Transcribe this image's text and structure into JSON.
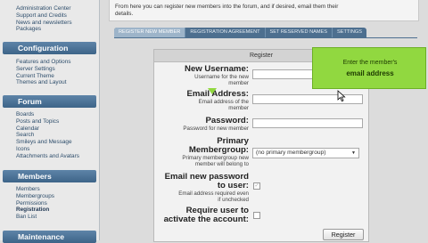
{
  "sidebar": {
    "top_links": [
      "Administration Center",
      "Support and Credits",
      "News and newsletters",
      "Packages"
    ],
    "sections": [
      {
        "title": "Configuration",
        "items": [
          "Features and Options",
          "Server Settings",
          "Current Theme",
          "Themes and Layout"
        ]
      },
      {
        "title": "Forum",
        "items": [
          "Boards",
          "Posts and Topics",
          "Calendar",
          "Search",
          "Smileys and Message Icons",
          "Attachments and Avatars"
        ]
      },
      {
        "title": "Members",
        "items": [
          "Members",
          "Membergroups",
          "Permissions",
          "Registration",
          "Ban List"
        ]
      },
      {
        "title": "Maintenance",
        "items": []
      }
    ],
    "active_item": "Registration"
  },
  "intro": {
    "line1": "From here you can register new members into the forum, and if desired, email them their",
    "line2": "details."
  },
  "tabs": [
    "Register New Member",
    "Registration Agreement",
    "Set Reserved Names",
    "Settings"
  ],
  "panel": {
    "title": "Register",
    "username": {
      "label": "New Username:",
      "hint1": "Username for the new",
      "hint2": "member"
    },
    "email": {
      "label": "Email Address:",
      "hint1": "Email address of the",
      "hint2": "member"
    },
    "password": {
      "label": "Password:",
      "hint1": "Password for new member"
    },
    "membergroup": {
      "label1": "Primary",
      "label2": "Membergroup:",
      "hint1": "Primary membergroup new",
      "hint2": "member will belong to",
      "selected": "(no primary membergroup)"
    },
    "email_password": {
      "label1": "Email new password",
      "label2": "to user:",
      "hint1": "Email address required even",
      "hint2": "if unchecked"
    },
    "require_activation": {
      "label1": "Require user to",
      "label2": "activate the account:"
    },
    "register_button": "Register"
  },
  "callout": {
    "line1": "Enter the member's",
    "line2": "email address"
  },
  "colors": {
    "callout": "#91d840",
    "sidebar_header": "#4d6f8f"
  }
}
